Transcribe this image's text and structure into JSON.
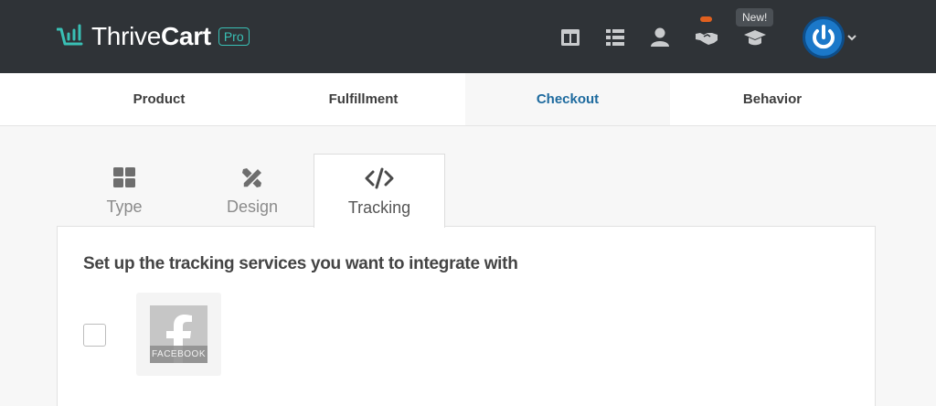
{
  "header": {
    "brand_word1": "Thrive",
    "brand_word2": "Cart",
    "pro_badge": "Pro",
    "new_tooltip": "New!",
    "icons": [
      "layout-icon",
      "list-icon",
      "user-icon",
      "handshake-icon",
      "graduation-cap-icon"
    ],
    "accent_color": "#39c0b5",
    "notification_color": "#e0601f"
  },
  "main_nav": {
    "items": [
      {
        "label": "Product"
      },
      {
        "label": "Fulfillment"
      },
      {
        "label": "Checkout",
        "active": true
      },
      {
        "label": "Behavior"
      }
    ],
    "active_color": "#1d6a9e"
  },
  "sub_tabs": {
    "items": [
      {
        "label": "Type",
        "icon": "grid-icon"
      },
      {
        "label": "Design",
        "icon": "tools-icon"
      },
      {
        "label": "Tracking",
        "icon": "code-icon",
        "active": true
      }
    ]
  },
  "tracking_panel": {
    "title": "Set up the tracking services you want to integrate with",
    "services": [
      {
        "name": "FACEBOOK",
        "checked": false,
        "icon": "facebook-icon"
      }
    ]
  }
}
